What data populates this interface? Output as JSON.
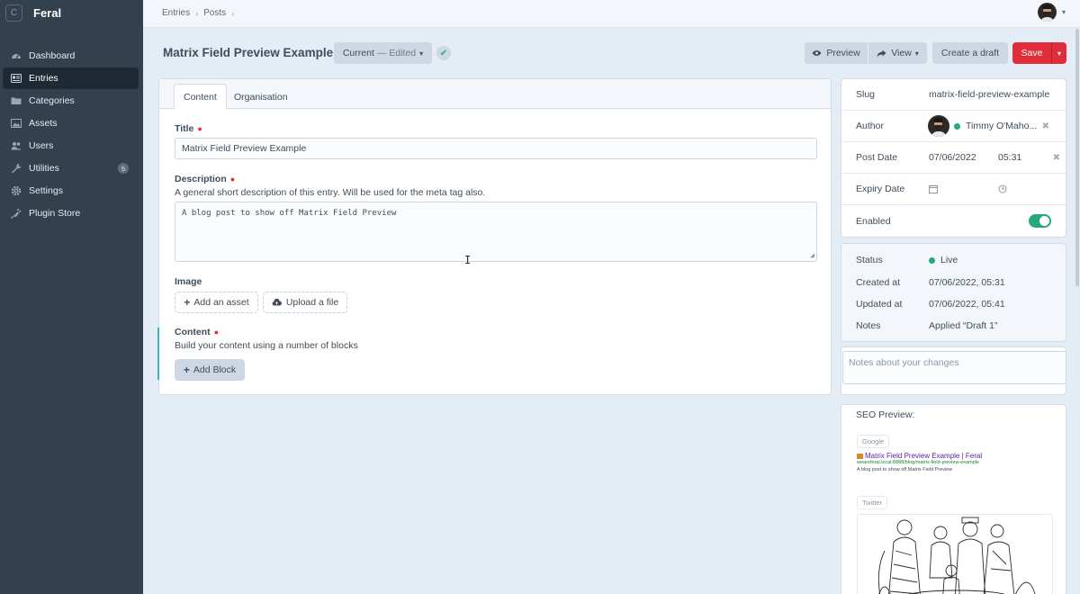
{
  "sidebar": {
    "site_initial": "C",
    "site_name": "Feral",
    "items": [
      {
        "label": "Dashboard",
        "icon": "gauge-icon"
      },
      {
        "label": "Entries",
        "icon": "entries-icon"
      },
      {
        "label": "Categories",
        "icon": "folder-icon"
      },
      {
        "label": "Assets",
        "icon": "image-icon"
      },
      {
        "label": "Users",
        "icon": "users-icon"
      },
      {
        "label": "Utilities",
        "icon": "wrench-icon",
        "badge": "5"
      },
      {
        "label": "Settings",
        "icon": "gear-icon"
      },
      {
        "label": "Plugin Store",
        "icon": "plug-icon"
      }
    ]
  },
  "breadcrumb": [
    "Entries",
    "Posts"
  ],
  "header": {
    "title": "Matrix Field Preview Example",
    "revision_current": "Current",
    "revision_sep": "—",
    "revision_state": "Edited",
    "preview": "Preview",
    "view": "View",
    "create_draft": "Create a draft",
    "save": "Save"
  },
  "tabs": [
    "Content",
    "Organisation"
  ],
  "fields": {
    "title_label": "Title",
    "title_value": "Matrix Field Preview Example",
    "description_label": "Description",
    "description_instructions": "A general short description of this entry. Will be used for the meta tag also.",
    "description_value": "A blog post to show off Matrix Field Preview",
    "image_label": "Image",
    "add_asset": "Add an asset",
    "upload_file": "Upload a file",
    "content_label": "Content",
    "content_instructions": "Build your content using a number of blocks",
    "add_block": "Add Block"
  },
  "meta": {
    "slug_label": "Slug",
    "slug_value": "matrix-field-preview-example",
    "author_label": "Author",
    "author_value": "Timmy O'Maho...",
    "post_date_label": "Post Date",
    "post_date": "07/06/2022",
    "post_time": "05:31",
    "expiry_label": "Expiry Date",
    "enabled_label": "Enabled",
    "enabled": true
  },
  "status": {
    "status_label": "Status",
    "status_value": "Live",
    "created_label": "Created at",
    "created_value": "07/06/2022, 05:31",
    "updated_label": "Updated at",
    "updated_value": "07/06/2022, 05:41",
    "notes_label": "Notes",
    "notes_value": "Applied “Draft 1”"
  },
  "notes_placeholder": "Notes about your changes",
  "seo": {
    "title": "SEO Preview:",
    "google_tag": "Google",
    "google_title": "Matrix Field Preview Example | Feral",
    "google_url": "weareferal.local:8888/blog/matrix-field-preview-example",
    "google_desc": "A blog post to show off Matrix Field Preview",
    "twitter_tag": "Twitter"
  },
  "colors": {
    "sidebar": "#33404d",
    "accent_save": "#e12d39",
    "live_green": "#27a87b"
  }
}
